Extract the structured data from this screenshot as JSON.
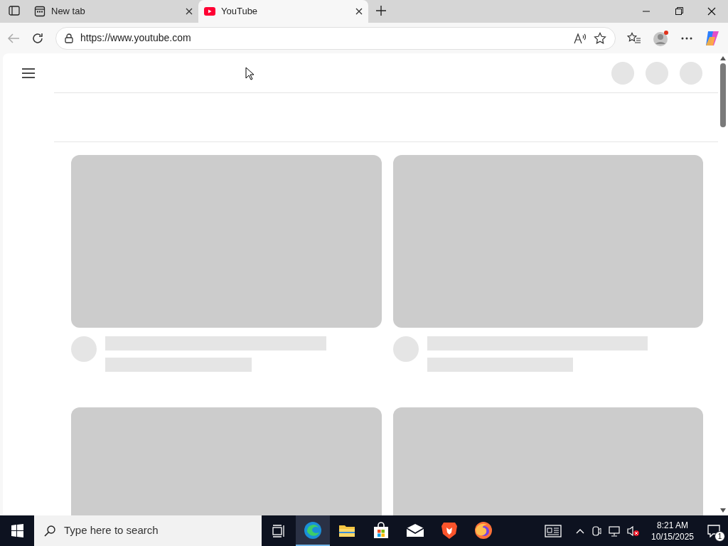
{
  "tabs": [
    {
      "title": "New tab",
      "selected": false,
      "kind": "newtab"
    },
    {
      "title": "YouTube",
      "selected": true,
      "kind": "youtube"
    }
  ],
  "address": {
    "url": "https://www.youtube.com"
  },
  "page": {
    "skeleton_cards": [
      {
        "kind": "video"
      },
      {
        "kind": "video"
      },
      {
        "kind": "video-partial"
      },
      {
        "kind": "video-partial"
      }
    ]
  },
  "taskbar": {
    "search_placeholder": "Type here to search",
    "apps": [
      {
        "kind": "edge",
        "selected": true
      },
      {
        "kind": "files",
        "selected": false
      },
      {
        "kind": "store",
        "selected": false
      },
      {
        "kind": "mail",
        "selected": false
      },
      {
        "kind": "brave",
        "selected": false
      },
      {
        "kind": "firefox",
        "selected": false
      }
    ],
    "time": "8:21 AM",
    "date": "10/15/2025",
    "notification_count": "1"
  }
}
